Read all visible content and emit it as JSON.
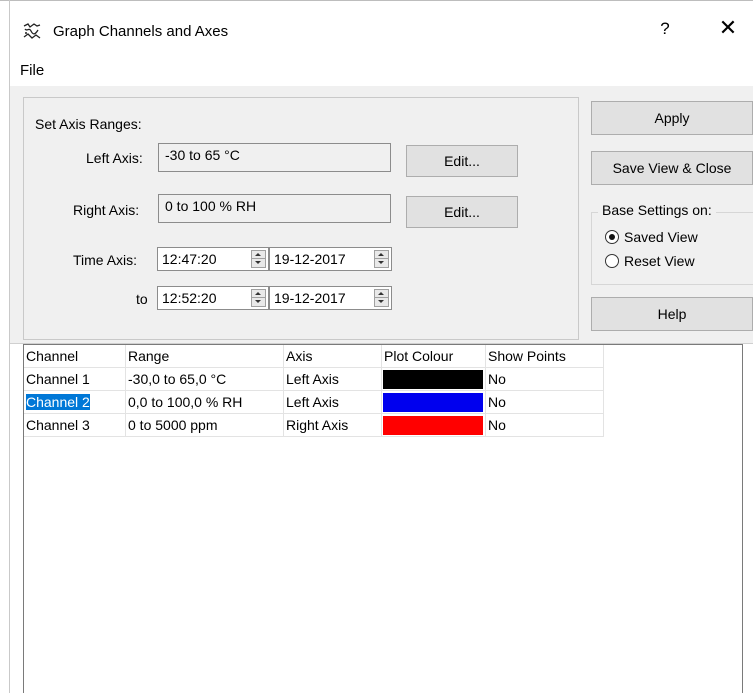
{
  "window": {
    "title": "Graph Channels and Axes",
    "help_label": "?",
    "close_label": "✕",
    "icon": "graph-app-icon"
  },
  "menu": {
    "file": "File"
  },
  "axis_ranges": {
    "group_label": "Set Axis Ranges:",
    "left_label": "Left Axis:",
    "left_value": "-30 to 65 °C",
    "left_edit": "Edit...",
    "right_label": "Right Axis:",
    "right_value": "0 to 100 % RH",
    "right_edit": "Edit...",
    "time_label": "Time Axis:",
    "time_from": "12:47:20",
    "date_from": "19-12-2017",
    "to_label": "to",
    "time_to": "12:52:20",
    "date_to": "19-12-2017"
  },
  "buttons": {
    "apply": "Apply",
    "save_close": "Save View & Close",
    "help": "Help"
  },
  "base_settings": {
    "label": "Base Settings on:",
    "options": [
      "Saved View",
      "Reset View"
    ],
    "selected": "Saved View"
  },
  "table": {
    "headers": [
      "Channel",
      "Range",
      "Axis",
      "Plot Colour",
      "Show Points"
    ],
    "rows": [
      {
        "channel": "Channel  1",
        "range": "-30,0 to 65,0 °C",
        "axis": "Left Axis",
        "colour": "#000000",
        "show_points": "No",
        "selected": false
      },
      {
        "channel": "Channel  2",
        "range": "0,0 to 100,0 % RH",
        "axis": "Left Axis",
        "colour": "#0000ee",
        "show_points": "No",
        "selected": true
      },
      {
        "channel": "Channel  3",
        "range": "0 to 5000 ppm",
        "axis": "Right Axis",
        "colour": "#ff0000",
        "show_points": "No",
        "selected": false
      }
    ]
  },
  "colors": {
    "selection": "#0078d7",
    "panel_bg": "#f0f0f0",
    "button_bg": "#e1e1e1"
  }
}
